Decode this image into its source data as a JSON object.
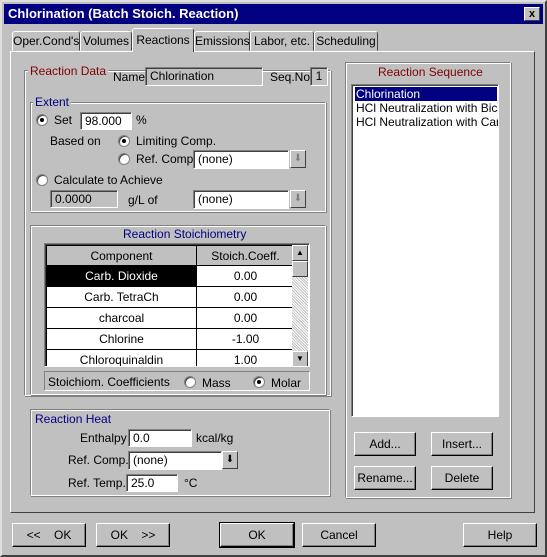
{
  "window": {
    "title": "Chlorination (Batch Stoich. Reaction)",
    "close_glyph": "x"
  },
  "tabs": [
    {
      "label": "Oper.Cond's"
    },
    {
      "label": "Volumes"
    },
    {
      "label": "Reactions"
    },
    {
      "label": "Emissions"
    },
    {
      "label": "Labor, etc."
    },
    {
      "label": "Scheduling"
    }
  ],
  "reaction_data": {
    "title": "Reaction Data",
    "name_label": "Name",
    "name_value": "Chlorination",
    "seqno_label": "Seq.No",
    "seqno_value": "1"
  },
  "extent": {
    "title": "Extent",
    "set_label": "Set",
    "set_value": "98.000",
    "unit": "%",
    "based_on_label": "Based on",
    "limiting_label": "Limiting Comp.",
    "ref_comp_label": "Ref. Comp.",
    "ref_comp_value": "(none)",
    "calc_label": "Calculate to Achieve",
    "calc_value": "0.0000",
    "gl_label": "g/L of",
    "gl_comp_value": "(none)"
  },
  "stoich": {
    "title": "Reaction Stoichiometry",
    "columns": [
      "Component",
      "Stoich.Coeff."
    ],
    "rows": [
      {
        "component": "Carb. Dioxide",
        "coeff": "0.00"
      },
      {
        "component": "Carb. TetraCh",
        "coeff": "0.00"
      },
      {
        "component": "charcoal",
        "coeff": "0.00"
      },
      {
        "component": "Chlorine",
        "coeff": "-1.00"
      },
      {
        "component": "Chloroquinaldin",
        "coeff": "1.00"
      }
    ],
    "coeff_label": "Stoichiom. Coefficients",
    "mass_label": "Mass",
    "molar_label": "Molar"
  },
  "heat": {
    "title": "Reaction Heat",
    "enthalpy_label": "Enthalpy",
    "enthalpy_value": "0.0",
    "enthalpy_unit": "kcal/kg",
    "ref_comp_label": "Ref. Comp.",
    "ref_comp_value": "(none)",
    "ref_temp_label": "Ref. Temp.",
    "ref_temp_value": "25.0",
    "ref_temp_unit": "°C"
  },
  "sequence": {
    "title": "Reaction Sequence",
    "items": [
      "Chlorination",
      "HCl Neutralization with Bicarb",
      "HCl Neutralization with Carbon"
    ],
    "add_label": "Add...",
    "insert_label": "Insert...",
    "rename_label": "Rename...",
    "delete_label": "Delete"
  },
  "footer": {
    "prev_ok_label": "<<    OK",
    "next_ok_label": "OK    >>",
    "ok_label": "OK",
    "cancel_label": "Cancel",
    "help_label": "Help"
  }
}
